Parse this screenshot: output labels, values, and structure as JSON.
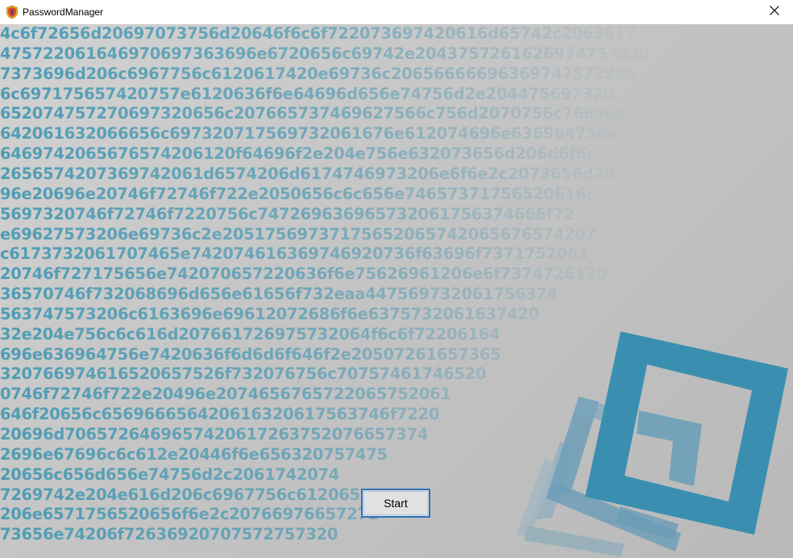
{
  "window": {
    "title": "PasswordManager",
    "icon": "shield-icon",
    "close_icon": "close-icon"
  },
  "background_hex_lines": [
    "4c6f72656d20697073756d20646f6c6f722073697420616d65742c2063617",
    "475722061646970697363696e6720656c69742e2043757261626974757220",
    "7373696d206c6967756c6120617420e69736c20656666696369747572206",
    "6c697175657420757e6120636f6e64696d656e74756d2e204475697320",
    "652074757270697320656c207665737469627566c756d2070756c76696e",
    "642061632066656c697320717569732061676e612074696e636964756e",
    "6469742065676574206120f64696f2e204e756e632073656d206d6f6c",
    "2656574207369742061d6574206d6174746973206e6f6e2c2073656d20",
    "96e20696e20746f72746f722e2050656c6c656e74657371756520616c",
    "5697320746f72746f7220756c747269636965732061756374666f72",
    "e69627573206e69736c2e20517569737175652065742065676574207",
    "c6173732061707465e742074616369746920736f63696f7371752061",
    "20746f727175656e742070657220636f6e75626961206e6f7374726120",
    "36570746f732068696d656e61656f732eaa447569732061756374",
    "563747573206c6163696e69612072686f6e6375732061637420",
    "32e204e756c6c616d207661726975732064f6c6f72206164",
    "696e636964756e7420636f6d6d6f646f2e20507261657365",
    "320766974616520657526f732076756c70757461746520",
    "0746f72746f722e20496e2074656765722065752061",
    "646f20656c656966656420616320617563746f7220",
    "20696d7065726469657420617263752076657374",
    "2696e67696c6c612e20446f6e656320757475",
    "20656c656d656e74756d2c2061742074",
    "7269742e204e616d206c6967756c612065",
    "206e6571756520656f6e2c20766976657272",
    "73656e74206f72636920707572757320"
  ],
  "start_button": {
    "label": "Start"
  }
}
